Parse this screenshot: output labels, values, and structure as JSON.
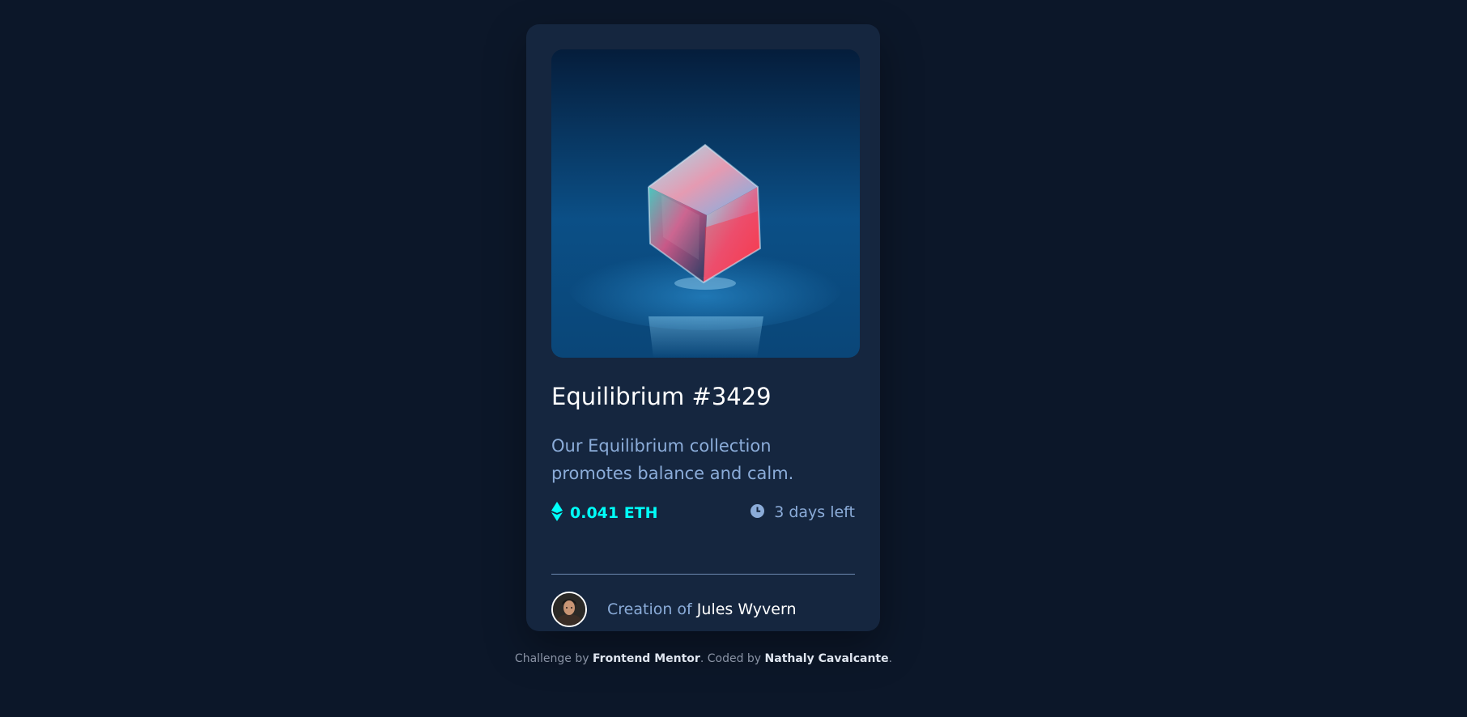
{
  "card": {
    "title": "Equilibrium #3429",
    "description": "Our Equilibrium collection promotes balance and calm.",
    "price": "0.041 ETH",
    "time_left": "3 days left",
    "creator_prefix": "Creation of",
    "creator_name": "Jules Wyvern",
    "icons": {
      "hero": "crystal-cube-image",
      "price": "ethereum-icon",
      "time": "clock-icon",
      "avatar": "avatar-image"
    }
  },
  "footer": {
    "text_1": "Challenge by",
    "link_1": "Frontend Mentor",
    "text_2": ". Coded by",
    "link_2": "Nathaly Cavalcante",
    "text_3": "."
  },
  "colors": {
    "page_bg": "#0c1729",
    "card_bg": "#15263f",
    "accent_cyan": "#00fff8",
    "soft_blue": "#8bacd9",
    "white": "#ffffff"
  }
}
